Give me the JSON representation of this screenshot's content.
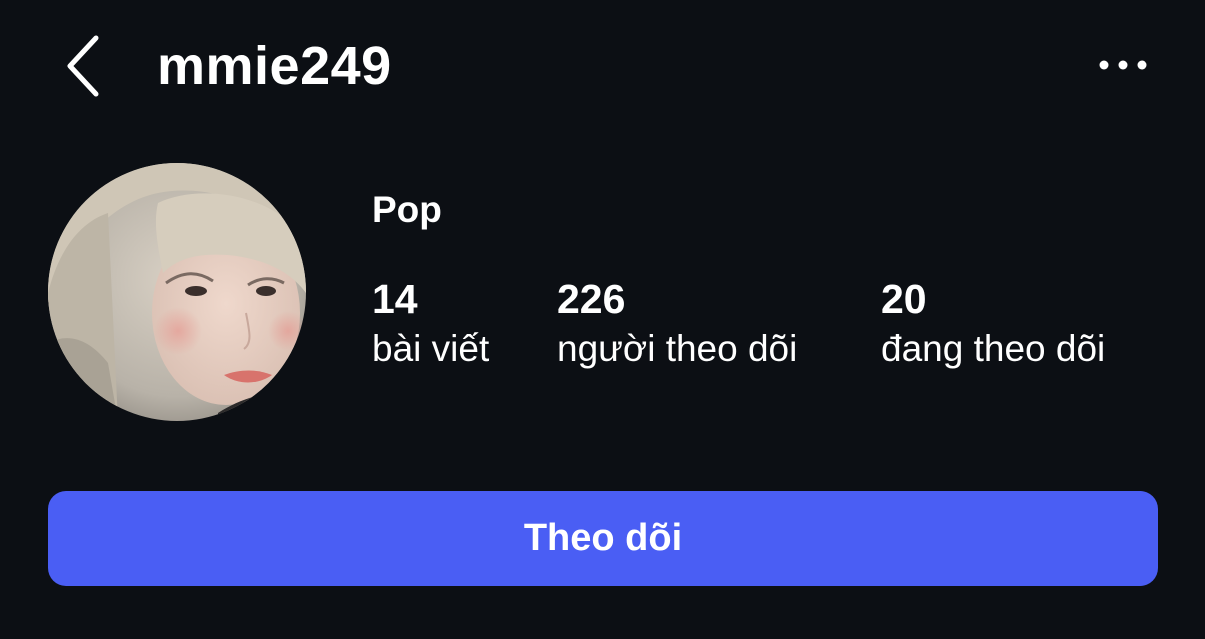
{
  "header": {
    "back_icon": "chevron-left-icon",
    "username": "mmie249",
    "more_icon": "more-horizontal-icon"
  },
  "profile": {
    "display_name": "Pop",
    "stats": [
      {
        "value": "14",
        "label": "bài viết"
      },
      {
        "value": "226",
        "label": "người theo dõi"
      },
      {
        "value": "20",
        "label": "đang theo dõi"
      }
    ]
  },
  "actions": {
    "follow_label": "Theo dõi"
  },
  "colors": {
    "background": "#0c0f14",
    "text": "#ffffff",
    "accent": "#4a5ef4"
  }
}
